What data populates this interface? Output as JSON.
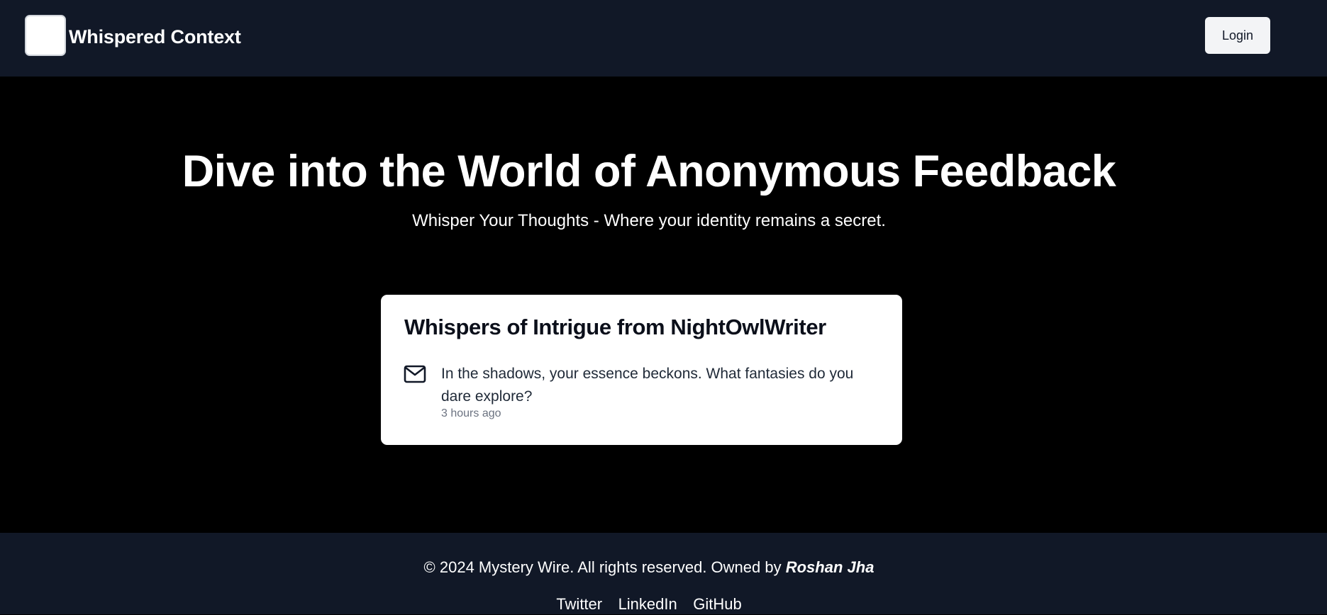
{
  "header": {
    "brand": "Whispered Context",
    "login_label": "Login"
  },
  "hero": {
    "title": "Dive into the World of Anonymous Feedback",
    "subtitle": "Whisper Your Thoughts - Where your identity remains a secret."
  },
  "card": {
    "title": "Whispers of Intrigue from NightOwlWriter",
    "icon": "mail-icon",
    "message": "In the shadows, your essence beckons. What fantasies do you dare explore?",
    "time": "3 hours ago"
  },
  "footer": {
    "copyright": "© 2024 Mystery Wire. All rights reserved. Owned by",
    "owner": "Roshan Jha",
    "links": [
      "Twitter",
      "LinkedIn",
      "GitHub"
    ]
  },
  "colors": {
    "header_bg": "#111827",
    "page_bg": "#000000",
    "card_bg": "#ffffff",
    "button_bg": "#f3f4f6"
  }
}
